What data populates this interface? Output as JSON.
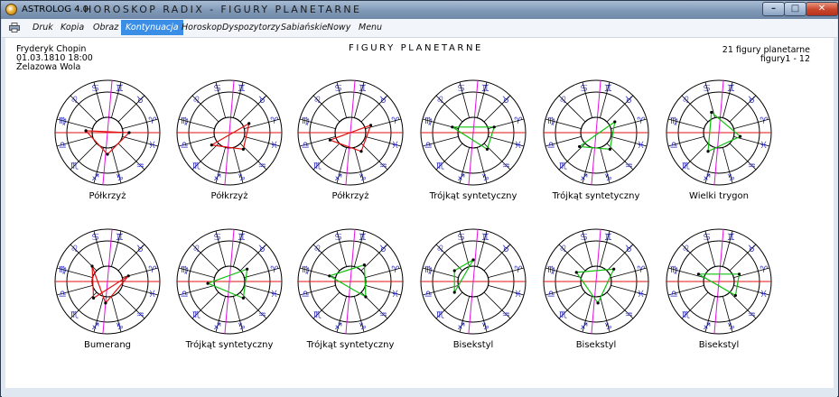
{
  "window": {
    "app_name": "ASTROLOG 4.0",
    "title": "HOROSKOP RADIX - FIGURY PLANETARNE",
    "min_glyph": "–",
    "max_glyph": "□",
    "close_glyph": "✕"
  },
  "menu": {
    "items": [
      "Druk",
      "Kopia",
      "Obraz",
      "Kontynuacja",
      "Horoskop",
      "Dyspozytorzy",
      "Sabiańskie",
      "Nowy",
      "Menu"
    ],
    "active_index": 3
  },
  "header": {
    "name": "Fryderyk Chopin",
    "date": "01.03.1810  18:00",
    "place": "Żelazowa Wola",
    "page_title": "FIGURY PLANETARNE",
    "count_label": "21 figury planetarne",
    "range_label": "figury1 - 12"
  },
  "colors": {
    "axis_asc": "#e01010",
    "axis_mc": "#e010e0",
    "figure_red": "#e01010",
    "figure_green": "#10c010",
    "zodiac_glyph": "#2020c0"
  },
  "zodiac_glyphs": [
    "♈",
    "♉",
    "♊",
    "♋",
    "♌",
    "♍",
    "♎",
    "♏",
    "♐",
    "♑",
    "♒",
    "♓"
  ],
  "charts": [
    {
      "label": "Półkrzyż",
      "color": "red",
      "figure": [
        180,
        90,
        355
      ]
    },
    {
      "label": "Półkrzyż",
      "color": "red",
      "figure": [
        205,
        130,
        35
      ]
    },
    {
      "label": "Półkrzyż",
      "color": "red",
      "figure": [
        200,
        120,
        20
      ]
    },
    {
      "label": "Trójkąt syntetyczny",
      "color": "green",
      "figure": [
        195,
        130,
        345
      ]
    },
    {
      "label": "Trójkąt syntetyczny",
      "color": "green",
      "figure": [
        210,
        130,
        40
      ]
    },
    {
      "label": "Wielki trygon",
      "color": "green",
      "figure": [
        170,
        60,
        290
      ]
    },
    {
      "label": "Bumerang",
      "color": "red",
      "figure": [
        195,
        85,
        315,
        50
      ]
    },
    {
      "label": "Trójkąt syntetyczny",
      "color": "green",
      "figure": [
        215,
        130,
        5
      ]
    },
    {
      "label": "Trójkąt syntetyczny",
      "color": "green",
      "figure": [
        230,
        135,
        345
      ]
    },
    {
      "label": "Bisekstyl",
      "color": "green",
      "figure": [
        270,
        30,
        330
      ]
    },
    {
      "label": "Bisekstyl",
      "color": "green",
      "figure": [
        215,
        95,
        335
      ]
    },
    {
      "label": "Bisekstyl",
      "color": "green",
      "figure": [
        200,
        140,
        340
      ]
    }
  ]
}
